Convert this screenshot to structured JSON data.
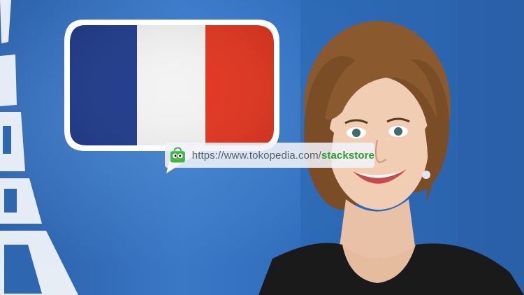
{
  "watermark": {
    "url_prefix": "https://www.tokopedia.com/",
    "url_store": "stackstore",
    "icon": "tokopedia-bag-icon",
    "store_color": "#2ca02c"
  },
  "colors": {
    "background": "#2f66b0",
    "flag_blue": "#1f3b8c",
    "flag_white": "#f3f3f3",
    "flag_red": "#e2351f"
  },
  "icons": {
    "tower": "eiffel-tower-icon",
    "bubble": "speech-bubble-icon"
  }
}
